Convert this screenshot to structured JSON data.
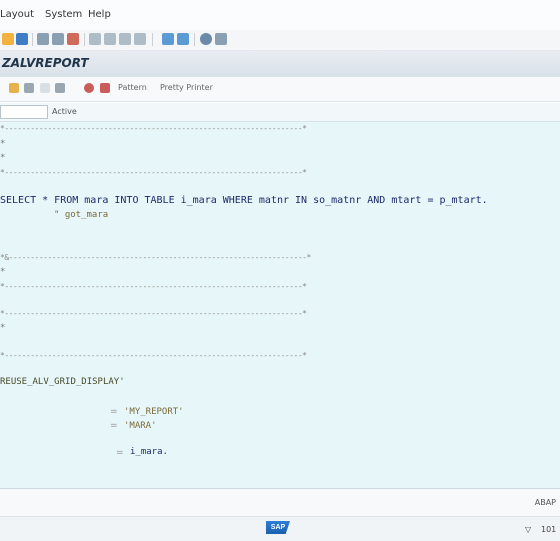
{
  "menu": {
    "items": [
      "Layout",
      "System",
      "Help"
    ]
  },
  "title": "ZALVREPORT",
  "app_toolbar": {
    "buttons": [
      "Pattern",
      "Pretty Printer"
    ]
  },
  "field_row": {
    "label": "Active"
  },
  "editor": {
    "dots_line": "*---------------------------------------------------------------------*",
    "comment_lines": [
      "*",
      "*",
      "*",
      "*"
    ],
    "select_line": "SELECT * FROM mara INTO TABLE i_mara WHERE matnr IN so_matnr AND mtart = p_mtart.",
    "select_line_tail": "\" got_mara",
    "perform_label": "*&---------------------------------------------------------------------*",
    "form_title": "REUSE_ALV_GRID_DISPLAY'",
    "param1": "'MY_REPORT'",
    "param2": "'MARA'",
    "param3": "i_mara."
  },
  "status_bar": {
    "right_text": "ABAP"
  },
  "bottom_bar": {
    "logo_text": "SAP",
    "session": "101",
    "marker": "▽"
  },
  "colors": {
    "editor_bg": "#e7f6f8",
    "title_text": "#20344a",
    "code_text": "#1c2a6b"
  }
}
